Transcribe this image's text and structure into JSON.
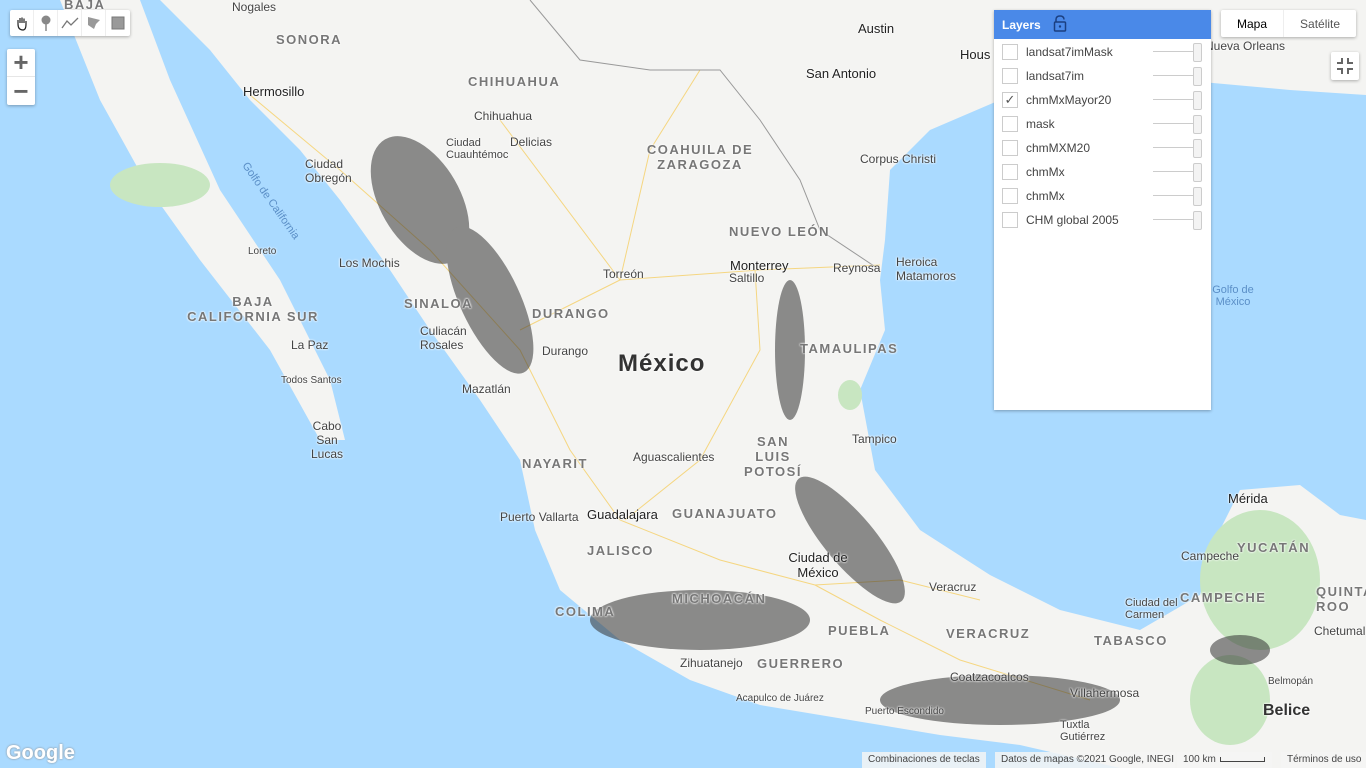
{
  "toolbar": {
    "tools": [
      "hand-icon",
      "marker-icon",
      "line-icon",
      "polygon-icon",
      "rectangle-icon"
    ]
  },
  "zoom": {
    "in": "+",
    "out": "−"
  },
  "layers": {
    "title": "Layers",
    "items": [
      {
        "name": "landsat7imMask",
        "checked": false
      },
      {
        "name": "landsat7im",
        "checked": false
      },
      {
        "name": "chmMxMayor20",
        "checked": true
      },
      {
        "name": "mask",
        "checked": false
      },
      {
        "name": "chmMXM20",
        "checked": false
      },
      {
        "name": "chmMx",
        "checked": false
      },
      {
        "name": "chmMx",
        "checked": false
      },
      {
        "name": "CHM global 2005",
        "checked": false
      }
    ]
  },
  "map_type": {
    "map": "Mapa",
    "satellite": "Satélite",
    "selected": "Mapa"
  },
  "map": {
    "labels": [
      "BAJA",
      "Nogales",
      "SONORA",
      "Hermosillo",
      "Ciudad Obregón",
      "Golfo de California",
      "CHIHUAHUA",
      "Chihuahua",
      "Ciudad Cuauhtémoc",
      "Delicias",
      "COAHUILA DE ZARAGOZA",
      "Austin",
      "San Antonio",
      "Hous",
      "Corpus Christi",
      "Nueva Orleans",
      "Loreto",
      "Los Mochis",
      "BAJA CALIFORNIA SUR",
      "La Paz",
      "Todos Santos",
      "Cabo San Lucas",
      "SINALOA",
      "Culiacán Rosales",
      "DURANGO",
      "Durango",
      "Torreón",
      "NUEVO LEÓN",
      "Monterrey",
      "Saltillo",
      "Reynosa",
      "Heroica Matamoros",
      "Golfo de México",
      "TAMAULIPAS",
      "México",
      "Mazatlán",
      "SAN LUIS POTOSÍ",
      "Tampico",
      "Aguascalientes",
      "NAYARIT",
      "Puerto Vallarta",
      "Guadalajara",
      "GUANAJUATO",
      "JALISCO",
      "Ciudad de México",
      "COLIMA",
      "MICHOACÁN",
      "PUEBLA",
      "Veracruz",
      "VERACRUZ",
      "GUERRERO",
      "Zihuatanejo",
      "Coatzacoalcos",
      "TABASCO",
      "Villahermosa",
      "Mérida",
      "YUCATÁN",
      "Campeche",
      "CAMPECHE",
      "Ciudad del Carmen",
      "QUINTANA ROO",
      "Chetumal",
      "Belmopán",
      "Belice",
      "Tuxtla Gutiérrez",
      "Puerto Escondido",
      "Acapulco de Juárez"
    ]
  },
  "footer": {
    "shortcuts": "Combinaciones de teclas",
    "attribution": "Datos de mapas ©2021 Google, INEGI",
    "scale": "100 km",
    "terms": "Términos de uso",
    "logo": "Google"
  },
  "colors": {
    "ocean": "#aadaff",
    "land": "#f4f4f2",
    "header": "#4a89e8",
    "vegetation": "#c8e6c1"
  }
}
